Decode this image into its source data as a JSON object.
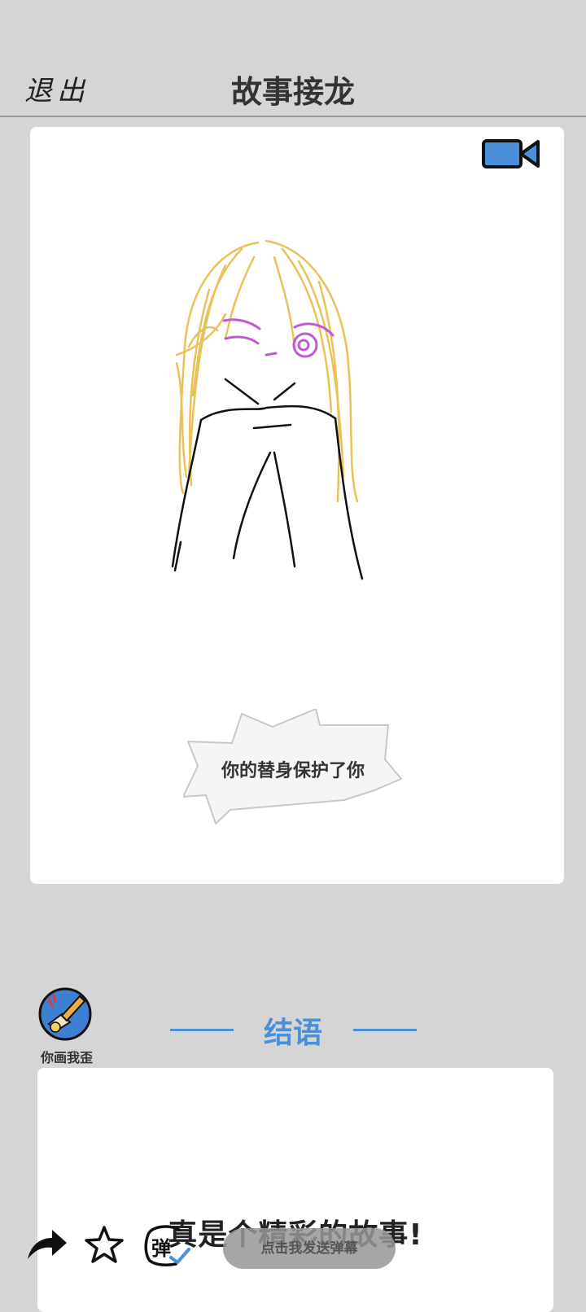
{
  "header": {
    "exit_label": "退出",
    "title": "故事接龙"
  },
  "story": {
    "caption": "你的替身保护了你"
  },
  "ending_section": {
    "app_name": "你画我歪",
    "title": "结语",
    "text": "真是个精彩的故事!"
  },
  "toolbar": {
    "danmaku_glyph": "弹",
    "danmaku_placeholder": "点击我发送弹幕"
  },
  "colors": {
    "background": "#d5d5d5",
    "accent_blue": "#4a90d9",
    "hair": "#e8c25a",
    "eyes": "#c05ad0"
  },
  "icons": [
    "video-camera-icon",
    "share-arrow-icon",
    "star-icon",
    "danmaku-toggle-icon"
  ]
}
